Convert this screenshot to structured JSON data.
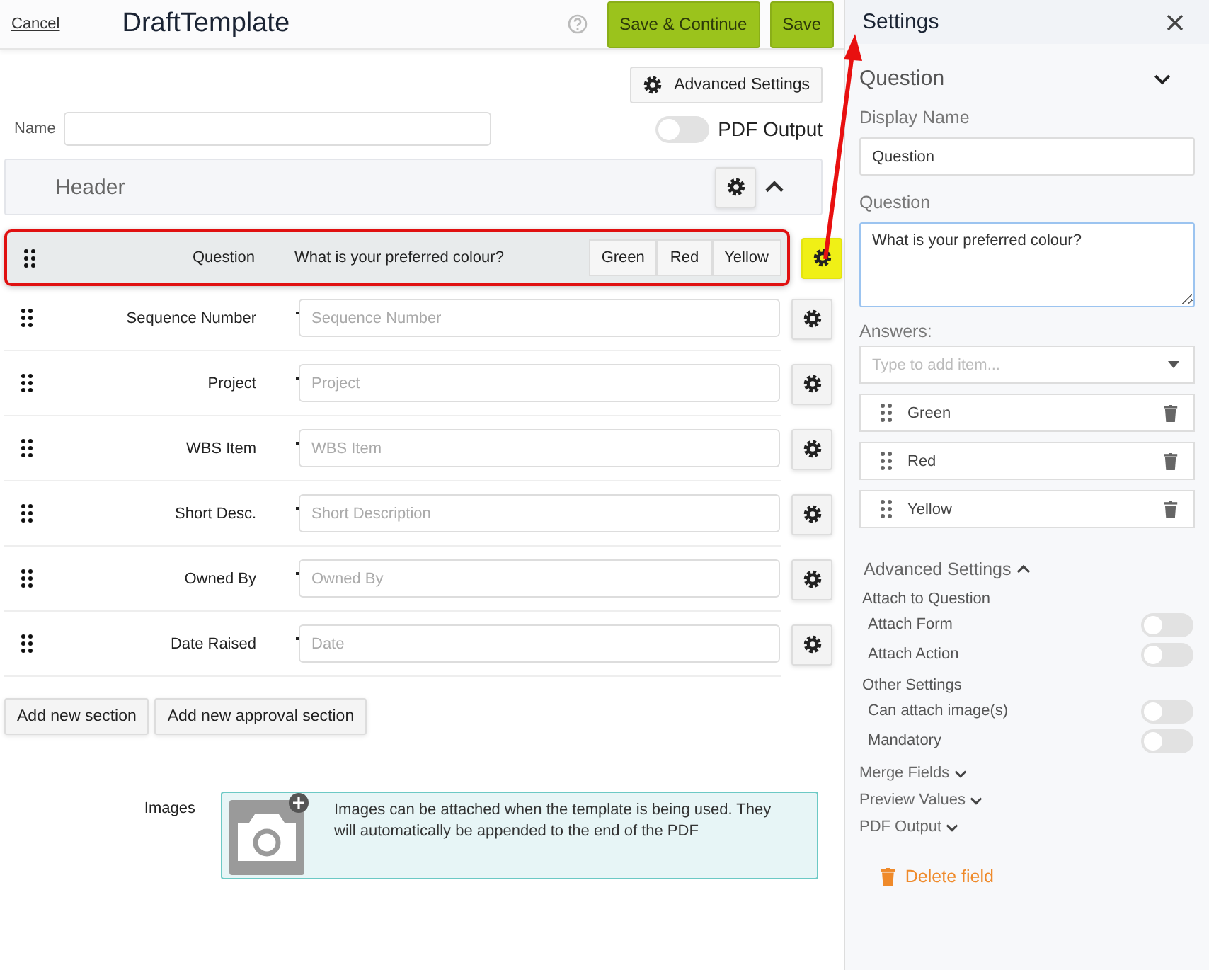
{
  "header": {
    "cancel": "Cancel",
    "title": "DraftTemplate",
    "buttons": [
      "Save & Continue",
      "Save"
    ]
  },
  "advanced_settings_button": "Advanced Settings",
  "name_field": {
    "label": "Name"
  },
  "pdf_output": {
    "label": "PDF Output",
    "on": false
  },
  "section": {
    "title": "Header",
    "expanded": true
  },
  "fields": [
    {
      "kind": "question",
      "label": "Question",
      "question": "What is your preferred colour?",
      "answers": [
        "Green",
        "Red",
        "Yellow"
      ],
      "selected": true
    },
    {
      "kind": "input",
      "label": "Sequence Number",
      "placeholder": "Sequence Number",
      "selected": false
    },
    {
      "kind": "input",
      "label": "Project",
      "placeholder": "Project",
      "selected": false
    },
    {
      "kind": "input",
      "label": "WBS Item",
      "placeholder": "WBS Item",
      "selected": false
    },
    {
      "kind": "input",
      "label": "Short Desc.",
      "placeholder": "Short Description",
      "selected": false
    },
    {
      "kind": "input",
      "label": "Owned By",
      "placeholder": "Owned By",
      "selected": false
    },
    {
      "kind": "input",
      "label": "Date Raised",
      "placeholder": "Date",
      "selected": false
    }
  ],
  "section_buttons": [
    "Add new section",
    "Add new approval section"
  ],
  "images": {
    "label": "Images",
    "hint": "Images can be attached when the template is being used. They will automatically be appended to the end of the PDF"
  },
  "settings": {
    "title": "Settings",
    "group": {
      "title": "Question",
      "expanded": true
    },
    "display_name": {
      "label": "Display Name",
      "value": "Question"
    },
    "question": {
      "label": "Question",
      "value": "What is your preferred colour?"
    },
    "answers": {
      "label": "Answers:",
      "placeholder": "Type to add item...",
      "items": [
        "Green",
        "Red",
        "Yellow"
      ]
    },
    "advanced": {
      "title": "Advanced Settings",
      "expanded": true,
      "groups": [
        {
          "title": "Attach to Question",
          "toggles": [
            {
              "label": "Attach Form",
              "on": false
            },
            {
              "label": "Attach Action",
              "on": false
            }
          ]
        },
        {
          "title": "Other Settings",
          "toggles": [
            {
              "label": "Can attach image(s)",
              "on": false
            },
            {
              "label": "Mandatory",
              "on": false
            }
          ]
        }
      ]
    },
    "collapsibles": [
      {
        "title": "Merge Fields",
        "expanded": false
      },
      {
        "title": "Preview Values",
        "expanded": false
      },
      {
        "title": "PDF Output",
        "expanded": false
      }
    ],
    "delete": "Delete field"
  }
}
